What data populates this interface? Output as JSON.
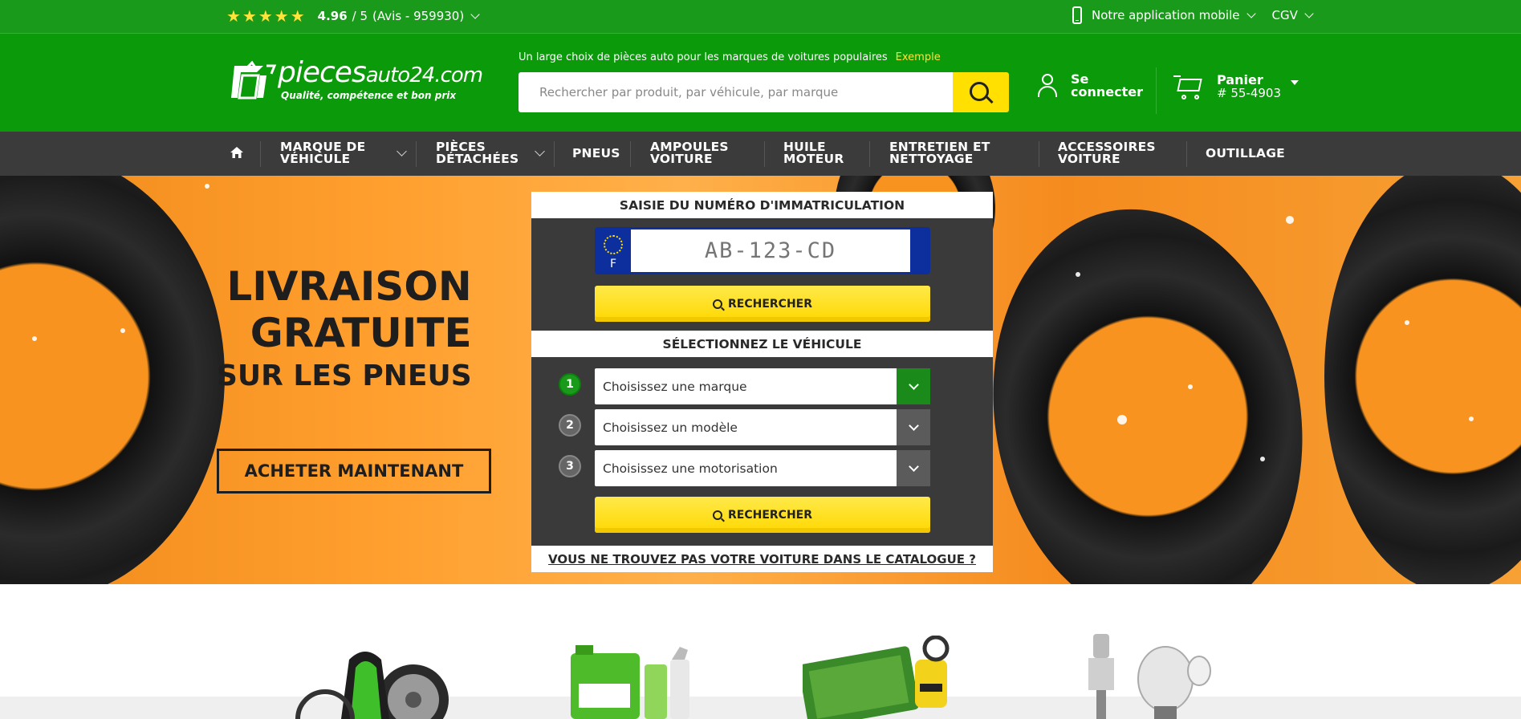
{
  "topbar": {
    "stars": "★★★★★",
    "rating_value": "4.96",
    "rating_scale": "/ 5",
    "reviews": "(Avis - 959930)",
    "mobile_app": "Notre application mobile",
    "cgv": "CGV"
  },
  "header": {
    "logo_main": "pieces",
    "logo_sub": "auto24.com",
    "logo_tagline": "Qualité, compétence et bon prix",
    "search_hint": "Un large choix de pièces auto pour les marques de voitures populaires",
    "search_example": "Exemple",
    "search_placeholder": "Rechercher par produit, par véhicule, par marque",
    "login_line1": "Se",
    "login_line2": "connecter",
    "cart_label": "Panier",
    "cart_number": "# 55-4903"
  },
  "nav": {
    "items": [
      {
        "line1": "MARQUE DE",
        "line2": "VÉHICULE"
      },
      {
        "line1": "PIÈCES",
        "line2": "DÉTACHÉES"
      },
      {
        "line1": "PNEUS",
        "line2": ""
      },
      {
        "line1": "AMPOULES",
        "line2": "VOITURE"
      },
      {
        "line1": "HUILE",
        "line2": "MOTEUR"
      },
      {
        "line1": "ENTRETIEN ET",
        "line2": "NETTOYAGE"
      },
      {
        "line1": "ACCESSOIRES",
        "line2": "VOITURE"
      },
      {
        "line1": "OUTILLAGE",
        "line2": ""
      }
    ]
  },
  "hero": {
    "line1": "LIVRAISON",
    "line2": "GRATUITE",
    "line3": "SUR LES PNEUS",
    "cta": "ACHETER MAINTENANT"
  },
  "finder": {
    "plate_title": "SAISIE DU NUMÉRO D'IMMATRICULATION",
    "plate_country": "F",
    "plate_placeholder": "AB-123-CD",
    "search_label": "RECHERCHER",
    "vehicle_title": "SÉLECTIONNEZ LE VÉHICULE",
    "steps": [
      "1",
      "2",
      "3"
    ],
    "brand_select": "Choisissez une marque",
    "model_select": "Choisissez un modèle",
    "engine_select": "Choisissez une motorisation",
    "not_found": "VOUS NE TROUVEZ PAS VOTRE VOITURE DANS LE CATALOGUE ?"
  },
  "colors": {
    "topbar": "#1a9a1a",
    "header": "#0a9a0a",
    "nav": "#3b3b3b",
    "accent_yellow": "#ffe000",
    "hero_orange": "#f8931f"
  }
}
